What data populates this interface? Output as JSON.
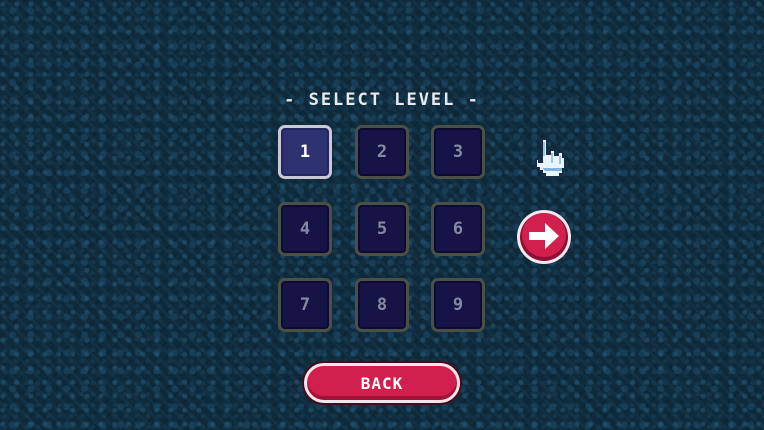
{
  "title": "- SELECT LEVEL -",
  "levels": [
    {
      "label": "1",
      "selected": true
    },
    {
      "label": "2",
      "selected": false
    },
    {
      "label": "3",
      "selected": false
    },
    {
      "label": "4",
      "selected": false
    },
    {
      "label": "5",
      "selected": false
    },
    {
      "label": "6",
      "selected": false
    },
    {
      "label": "7",
      "selected": false
    },
    {
      "label": "8",
      "selected": false
    },
    {
      "label": "9",
      "selected": false
    }
  ],
  "buttons": {
    "back_label": "BACK",
    "next_icon": "arrow-right-icon"
  },
  "cursor_icon": "pointing-hand-icon",
  "colors": {
    "background": "#0f2a3a",
    "tile": "#161446",
    "tile_selected": "#2d3270",
    "accent": "#d11f4e"
  }
}
